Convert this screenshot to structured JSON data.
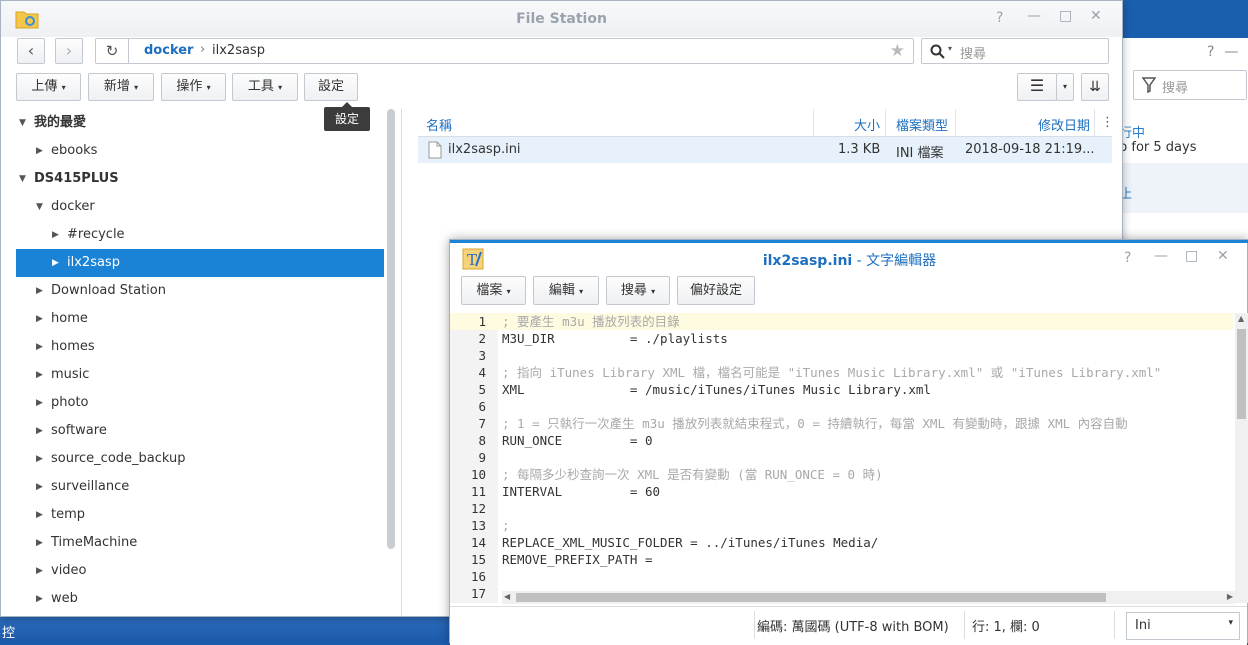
{
  "file_station": {
    "title": "File Station",
    "path": [
      "docker",
      "ilx2sasp"
    ],
    "search_placeholder": "搜尋",
    "toolbar": {
      "upload": "上傳",
      "create": "新增",
      "action": "操作",
      "tools": "工具",
      "settings": "設定"
    },
    "tooltip": "設定",
    "tree": [
      {
        "label": "我的最愛",
        "level": 0,
        "expanded": true,
        "bold": true
      },
      {
        "label": "ebooks",
        "level": 1
      },
      {
        "label": "DS415PLUS",
        "level": 0,
        "expanded": true,
        "bold": true
      },
      {
        "label": "docker",
        "level": 1,
        "expanded": true
      },
      {
        "label": "#recycle",
        "level": 2
      },
      {
        "label": "ilx2sasp",
        "level": 2,
        "selected": true
      },
      {
        "label": "Download Station",
        "level": 1
      },
      {
        "label": "home",
        "level": 1
      },
      {
        "label": "homes",
        "level": 1
      },
      {
        "label": "music",
        "level": 1
      },
      {
        "label": "photo",
        "level": 1
      },
      {
        "label": "software",
        "level": 1
      },
      {
        "label": "source_code_backup",
        "level": 1
      },
      {
        "label": "surveillance",
        "level": 1
      },
      {
        "label": "temp",
        "level": 1
      },
      {
        "label": "TimeMachine",
        "level": 1
      },
      {
        "label": "video",
        "level": 1
      },
      {
        "label": "web",
        "level": 1
      }
    ],
    "columns": {
      "name": "名稱",
      "size": "大小",
      "type": "檔案類型",
      "modified": "修改日期"
    },
    "files": [
      {
        "name": "ilx2sasp.ini",
        "size": "1.3 KB",
        "type": "INI 檔案",
        "modified": "2018-09-18 21:19..."
      }
    ]
  },
  "background_window": {
    "search_placeholder": "搜尋",
    "line1": "行中",
    "line2": "p for 5 days",
    "line3": "止"
  },
  "editor": {
    "filename": "ilx2sasp.ini",
    "app_title": " - 文字編輯器",
    "menu": {
      "file": "檔案",
      "edit": "編輯",
      "search": "搜尋",
      "prefs": "偏好設定"
    },
    "lines": [
      {
        "n": "1",
        "text": "; 要產生 m3u 播放列表的目錄",
        "comment": true
      },
      {
        "n": "2",
        "text": "M3U_DIR          = ./playlists"
      },
      {
        "n": "3",
        "text": ""
      },
      {
        "n": "4",
        "text": "; 指向 iTunes Library XML 檔，檔名可能是 \"iTunes Music Library.xml\" 或 \"iTunes Library.xml\"",
        "comment": true
      },
      {
        "n": "5",
        "text": "XML              = /music/iTunes/iTunes Music Library.xml"
      },
      {
        "n": "6",
        "text": ""
      },
      {
        "n": "7",
        "text": "; 1 = 只執行一次產生 m3u 播放列表就結束程式，0 = 持續執行，每當 XML 有變動時，跟據 XML 內容自動",
        "comment": true
      },
      {
        "n": "8",
        "text": "RUN_ONCE         = 0"
      },
      {
        "n": "9",
        "text": ""
      },
      {
        "n": "10",
        "text": "; 每隔多少秒查詢一次 XML 是否有變動 (當 RUN_ONCE = 0 時)",
        "comment": true
      },
      {
        "n": "11",
        "text": "INTERVAL         = 60"
      },
      {
        "n": "12",
        "text": ""
      },
      {
        "n": "13",
        "text": ";",
        "comment": true
      },
      {
        "n": "14",
        "text": "REPLACE_XML_MUSIC_FOLDER = ../iTunes/iTunes Media/"
      },
      {
        "n": "15",
        "text": "REMOVE_PREFIX_PATH ="
      },
      {
        "n": "16",
        "text": ""
      },
      {
        "n": "17",
        "text": ""
      }
    ],
    "status": {
      "encoding": "編碼: 萬國碼 (UTF-8 with BOM)",
      "position": "行: 1, 欄: 0",
      "language": "Ini"
    }
  },
  "taskbar": {
    "label": "控"
  }
}
